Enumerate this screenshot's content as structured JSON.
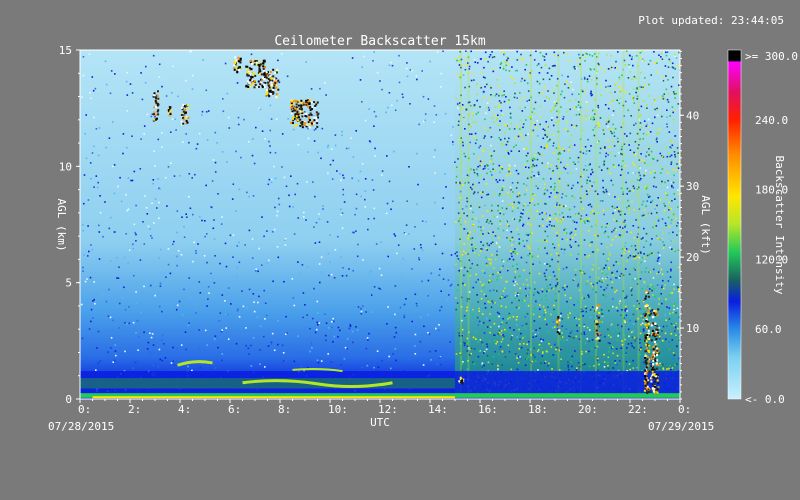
{
  "header": {
    "updated": "Plot updated: 23:44:05"
  },
  "chart_data": {
    "type": "heatmap",
    "title": "Ceilometer Backscatter 15km",
    "xlabel": "UTC",
    "ylabel_left": "AGL (km)",
    "ylabel_right": "AGL (kft)",
    "colorbar_label": "Backscatter Intensity",
    "date_start": "07/28/2015",
    "date_end": "07/29/2015",
    "x_range": [
      0,
      24
    ],
    "y_range_km": [
      0,
      15
    ],
    "y_range_kft": [
      0,
      49.2
    ],
    "x_ticks": [
      {
        "value": 0,
        "label": "0:"
      },
      {
        "value": 2,
        "label": "2:"
      },
      {
        "value": 4,
        "label": "4:"
      },
      {
        "value": 6,
        "label": "6:"
      },
      {
        "value": 8,
        "label": "8:"
      },
      {
        "value": 10,
        "label": "10:"
      },
      {
        "value": 12,
        "label": "12:"
      },
      {
        "value": 14,
        "label": "14:"
      },
      {
        "value": 16,
        "label": "16:"
      },
      {
        "value": 18,
        "label": "18:"
      },
      {
        "value": 20,
        "label": "20:"
      },
      {
        "value": 22,
        "label": "22:"
      },
      {
        "value": 24,
        "label": "0:"
      }
    ],
    "y_ticks_km": [
      {
        "value": 0,
        "label": "0"
      },
      {
        "value": 5,
        "label": "5"
      },
      {
        "value": 10,
        "label": "10"
      },
      {
        "value": 15,
        "label": "15"
      }
    ],
    "y_ticks_kft": [
      {
        "value": 10,
        "label": "10"
      },
      {
        "value": 20,
        "label": "20"
      },
      {
        "value": 30,
        "label": "30"
      },
      {
        "value": 40,
        "label": "40"
      }
    ],
    "colorbar_range": [
      0,
      300
    ],
    "colorbar_ticks": [
      {
        "value": 0,
        "label": "<-  0.0"
      },
      {
        "value": 60,
        "label": "60.0"
      },
      {
        "value": 120,
        "label": "120.0"
      },
      {
        "value": 180,
        "label": "180.0"
      },
      {
        "value": 240,
        "label": "240.0"
      },
      {
        "value": 300,
        "label": ">= 300.0"
      }
    ],
    "colormap": [
      "#c8f0ff",
      "#7ad0f0",
      "#2a8ae6",
      "#0a1ee0",
      "#1a6060",
      "#22c85a",
      "#b4e628",
      "#ffe600",
      "#ff8c00",
      "#ff2000",
      "#e01060",
      "#ff00ff",
      "#000000"
    ],
    "cloud_patches": [
      {
        "t_start": 2.9,
        "t_end": 3.1,
        "h_bottom": 12.0,
        "h_top": 13.3
      },
      {
        "t_start": 3.5,
        "t_end": 3.6,
        "h_bottom": 12.2,
        "h_top": 12.6
      },
      {
        "t_start": 4.0,
        "t_end": 4.3,
        "h_bottom": 11.8,
        "h_top": 12.7
      },
      {
        "t_start": 6.1,
        "t_end": 6.4,
        "h_bottom": 14.0,
        "h_top": 14.8
      },
      {
        "t_start": 6.6,
        "t_end": 7.4,
        "h_bottom": 13.4,
        "h_top": 14.6
      },
      {
        "t_start": 7.4,
        "t_end": 7.9,
        "h_bottom": 13.0,
        "h_top": 14.2
      },
      {
        "t_start": 8.4,
        "t_end": 9.5,
        "h_bottom": 11.7,
        "h_top": 12.9
      }
    ],
    "low_cloud_columns": [
      {
        "t_start": 15.1,
        "t_end": 15.3,
        "h_bottom": 0.7,
        "h_top": 1.0
      },
      {
        "t_start": 19.0,
        "t_end": 19.15,
        "h_bottom": 2.8,
        "h_top": 3.6
      },
      {
        "t_start": 20.6,
        "t_end": 20.75,
        "h_bottom": 2.5,
        "h_top": 4.1
      },
      {
        "t_start": 22.55,
        "t_end": 22.75,
        "h_bottom": 0.2,
        "h_top": 4.7
      },
      {
        "t_start": 22.8,
        "t_end": 23.1,
        "h_bottom": 0.3,
        "h_top": 3.9
      }
    ]
  }
}
